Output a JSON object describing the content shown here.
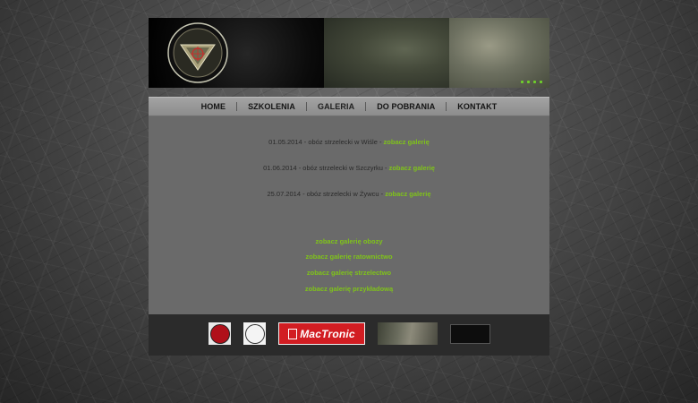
{
  "nav": {
    "items": [
      {
        "label": "HOME"
      },
      {
        "label": "SZKOLENIA"
      },
      {
        "label": "GALERIA"
      },
      {
        "label": "DO POBRANIA"
      },
      {
        "label": "KONTAKT"
      }
    ],
    "active": "GALERIA"
  },
  "content": {
    "entries": [
      {
        "text": "01.05.2014 - obóz strzelecki w Wiśle - ",
        "link": "zobacz galerię"
      },
      {
        "text": "01.06.2014 - obóz strzelecki w Szczyrku - ",
        "link": "zobacz galerię"
      },
      {
        "text": "25.07.2014 - obóz strzelecki w Żywcu - ",
        "link": "zobacz galerię"
      }
    ],
    "gallery_links": [
      "zobacz galerię obozy",
      "zobacz galerię ratownictwo",
      "zobacz galerię strzelectwo",
      "zobacz galerię przykładową"
    ]
  },
  "footer": {
    "partners": [
      {
        "name": "partner-red-emblem-logo"
      },
      {
        "name": "partner-circle-logo"
      },
      {
        "name": "mactronic-logo",
        "label": "MacTronic"
      },
      {
        "name": "partner-photo-logo"
      },
      {
        "name": "partner-dark-logo"
      }
    ]
  },
  "colors": {
    "accent_green": "#7fc31a",
    "content_bg": "#6a6a6a",
    "nav_bg": "#999999",
    "footer_bg": "#2b2b2b"
  }
}
